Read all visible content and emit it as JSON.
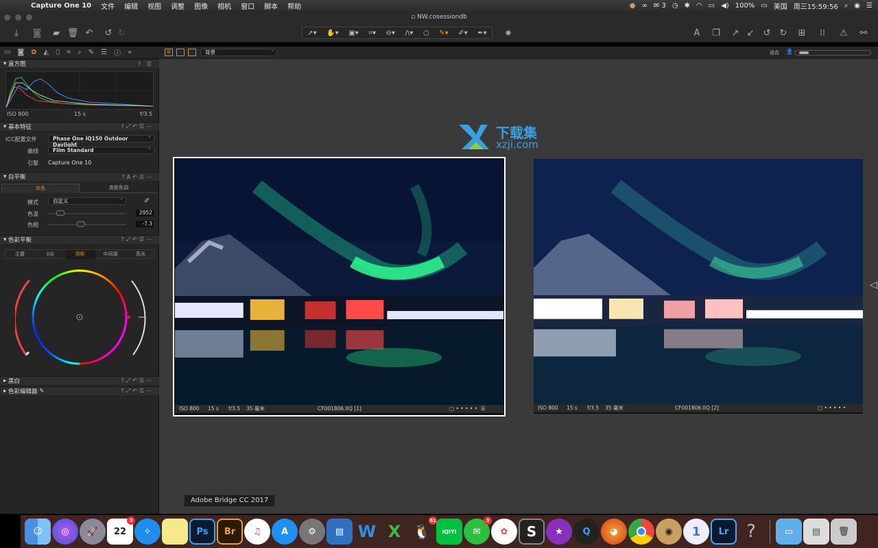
{
  "menubar": {
    "app": "Capture One 10",
    "items": [
      "文件",
      "编辑",
      "视图",
      "调整",
      "图像",
      "相机",
      "窗口",
      "脚本",
      "帮助"
    ],
    "wechat_count": "3",
    "battery": "100%",
    "input_source": "美国",
    "clock": "周三15:59:56"
  },
  "window": {
    "title": "NW.cosessiondb"
  },
  "viewer_toolbar": {
    "variant_select": "背景",
    "zoom_label": "适合"
  },
  "histogram": {
    "title": "直方图",
    "iso": "ISO 800",
    "shutter": "15 s",
    "aperture": "f/3.5"
  },
  "basic": {
    "title": "基本特征",
    "icc_label": "ICC配置文件",
    "icc_value": "Phase One IQ150 Outdoor Daylight",
    "curve_label": "曲线",
    "curve_value": "Film Standard",
    "engine_label": "引擎",
    "engine_value": "Capture One 10"
  },
  "white_balance": {
    "title": "白平衡",
    "tab_color": "灰色",
    "tab_skin": "皮肤色调",
    "mode_label": "模式",
    "mode_value": "自定义",
    "temp_label": "色温",
    "temp_value": "2952",
    "tint_label": "色相",
    "tint_value": "-7.3"
  },
  "color_balance": {
    "title": "色彩平衡",
    "tabs": [
      "主要",
      "3向",
      "阴影",
      "中间调",
      "高光"
    ],
    "active_tab": 2
  },
  "bw": {
    "title": "黑白"
  },
  "color_editor": {
    "title": "色彩编辑器"
  },
  "photos": [
    {
      "iso": "ISO 800",
      "shutter": "15 s",
      "aperture": "f/3.5",
      "focal": "35 毫米",
      "name": "CF001806.IIQ [1]"
    },
    {
      "iso": "ISO 800",
      "shutter": "15 s",
      "aperture": "f/3.5",
      "focal": "35 毫米",
      "name": "CF001806.IIQ [2]"
    }
  ],
  "watermark": {
    "text_cn": "下载集",
    "text_url": "xzji.com"
  },
  "tooltip": "Adobe Bridge CC 2017",
  "dock": {
    "calendar_day": "22",
    "calendar_badge": "3",
    "qq_badge": "81",
    "wechat_badge": "3",
    "ps": "Ps",
    "br": "Br",
    "lr": "Lr",
    "word": "W",
    "excel": "X",
    "iqiyi": "iQIYI",
    "s": "S",
    "one": "1",
    "q": "?"
  }
}
